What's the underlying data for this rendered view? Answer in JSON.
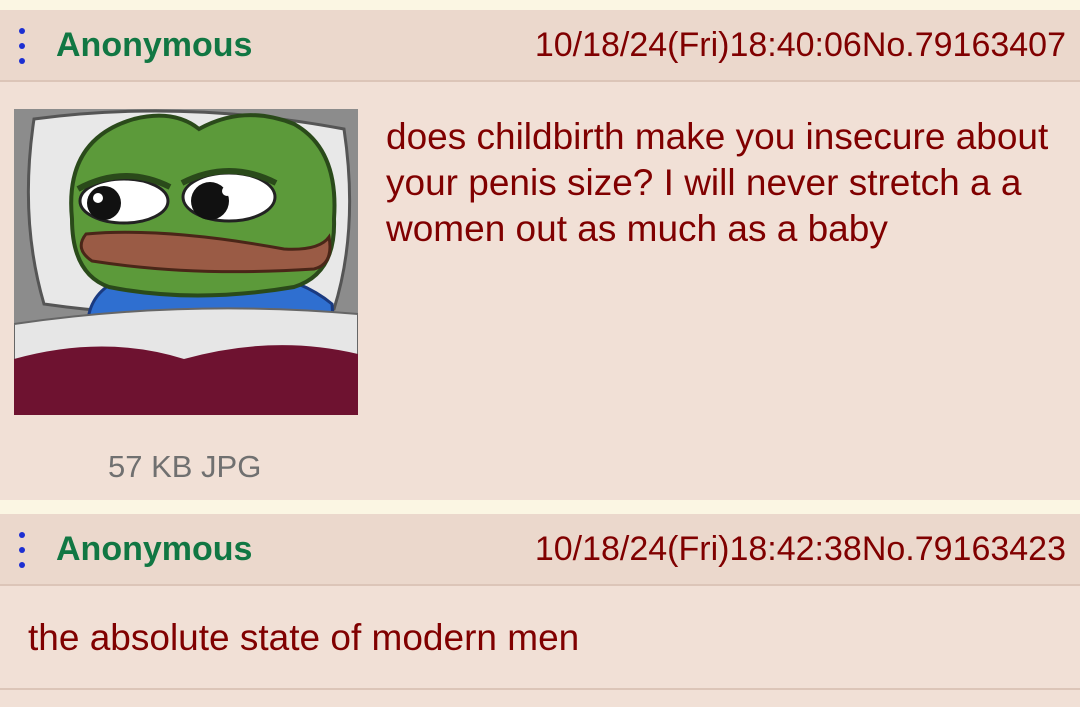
{
  "posts": [
    {
      "name": "Anonymous",
      "datetime": "10/18/24(Fri)18:40:06",
      "number": "No.79163407",
      "image": {
        "file_info": "57 KB JPG",
        "icon": "pepe-frog-thumbnail"
      },
      "comment": "does childbirth make you insecure about your penis size? I will never stretch a a women out as much as a baby"
    },
    {
      "name": "Anonymous",
      "datetime": "10/18/24(Fri)18:42:38",
      "number": "No.79163423",
      "comment": "the absolute state of modern men"
    }
  ],
  "colors": {
    "name": "#117743",
    "text": "#800000",
    "header_bg": "#ebd8cc",
    "post_bg": "#f1e0d6",
    "page_bg": "#fbf6e3",
    "menu_dots": "#1c2fd2"
  }
}
